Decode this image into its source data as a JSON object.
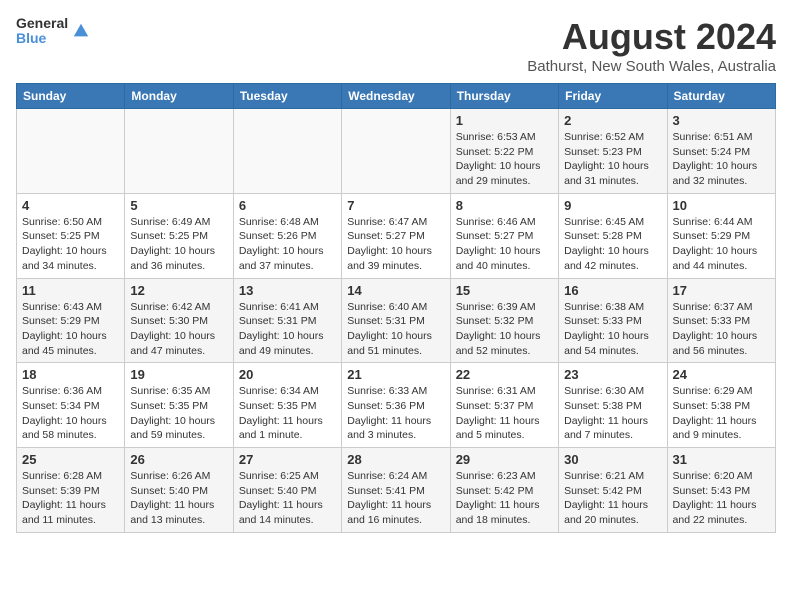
{
  "header": {
    "logo_line1": "General",
    "logo_line2": "Blue",
    "month": "August 2024",
    "location": "Bathurst, New South Wales, Australia"
  },
  "weekdays": [
    "Sunday",
    "Monday",
    "Tuesday",
    "Wednesday",
    "Thursday",
    "Friday",
    "Saturday"
  ],
  "weeks": [
    [
      {
        "day": "",
        "info": ""
      },
      {
        "day": "",
        "info": ""
      },
      {
        "day": "",
        "info": ""
      },
      {
        "day": "",
        "info": ""
      },
      {
        "day": "1",
        "info": "Sunrise: 6:53 AM\nSunset: 5:22 PM\nDaylight: 10 hours\nand 29 minutes."
      },
      {
        "day": "2",
        "info": "Sunrise: 6:52 AM\nSunset: 5:23 PM\nDaylight: 10 hours\nand 31 minutes."
      },
      {
        "day": "3",
        "info": "Sunrise: 6:51 AM\nSunset: 5:24 PM\nDaylight: 10 hours\nand 32 minutes."
      }
    ],
    [
      {
        "day": "4",
        "info": "Sunrise: 6:50 AM\nSunset: 5:25 PM\nDaylight: 10 hours\nand 34 minutes."
      },
      {
        "day": "5",
        "info": "Sunrise: 6:49 AM\nSunset: 5:25 PM\nDaylight: 10 hours\nand 36 minutes."
      },
      {
        "day": "6",
        "info": "Sunrise: 6:48 AM\nSunset: 5:26 PM\nDaylight: 10 hours\nand 37 minutes."
      },
      {
        "day": "7",
        "info": "Sunrise: 6:47 AM\nSunset: 5:27 PM\nDaylight: 10 hours\nand 39 minutes."
      },
      {
        "day": "8",
        "info": "Sunrise: 6:46 AM\nSunset: 5:27 PM\nDaylight: 10 hours\nand 40 minutes."
      },
      {
        "day": "9",
        "info": "Sunrise: 6:45 AM\nSunset: 5:28 PM\nDaylight: 10 hours\nand 42 minutes."
      },
      {
        "day": "10",
        "info": "Sunrise: 6:44 AM\nSunset: 5:29 PM\nDaylight: 10 hours\nand 44 minutes."
      }
    ],
    [
      {
        "day": "11",
        "info": "Sunrise: 6:43 AM\nSunset: 5:29 PM\nDaylight: 10 hours\nand 45 minutes."
      },
      {
        "day": "12",
        "info": "Sunrise: 6:42 AM\nSunset: 5:30 PM\nDaylight: 10 hours\nand 47 minutes."
      },
      {
        "day": "13",
        "info": "Sunrise: 6:41 AM\nSunset: 5:31 PM\nDaylight: 10 hours\nand 49 minutes."
      },
      {
        "day": "14",
        "info": "Sunrise: 6:40 AM\nSunset: 5:31 PM\nDaylight: 10 hours\nand 51 minutes."
      },
      {
        "day": "15",
        "info": "Sunrise: 6:39 AM\nSunset: 5:32 PM\nDaylight: 10 hours\nand 52 minutes."
      },
      {
        "day": "16",
        "info": "Sunrise: 6:38 AM\nSunset: 5:33 PM\nDaylight: 10 hours\nand 54 minutes."
      },
      {
        "day": "17",
        "info": "Sunrise: 6:37 AM\nSunset: 5:33 PM\nDaylight: 10 hours\nand 56 minutes."
      }
    ],
    [
      {
        "day": "18",
        "info": "Sunrise: 6:36 AM\nSunset: 5:34 PM\nDaylight: 10 hours\nand 58 minutes."
      },
      {
        "day": "19",
        "info": "Sunrise: 6:35 AM\nSunset: 5:35 PM\nDaylight: 10 hours\nand 59 minutes."
      },
      {
        "day": "20",
        "info": "Sunrise: 6:34 AM\nSunset: 5:35 PM\nDaylight: 11 hours\nand 1 minute."
      },
      {
        "day": "21",
        "info": "Sunrise: 6:33 AM\nSunset: 5:36 PM\nDaylight: 11 hours\nand 3 minutes."
      },
      {
        "day": "22",
        "info": "Sunrise: 6:31 AM\nSunset: 5:37 PM\nDaylight: 11 hours\nand 5 minutes."
      },
      {
        "day": "23",
        "info": "Sunrise: 6:30 AM\nSunset: 5:38 PM\nDaylight: 11 hours\nand 7 minutes."
      },
      {
        "day": "24",
        "info": "Sunrise: 6:29 AM\nSunset: 5:38 PM\nDaylight: 11 hours\nand 9 minutes."
      }
    ],
    [
      {
        "day": "25",
        "info": "Sunrise: 6:28 AM\nSunset: 5:39 PM\nDaylight: 11 hours\nand 11 minutes."
      },
      {
        "day": "26",
        "info": "Sunrise: 6:26 AM\nSunset: 5:40 PM\nDaylight: 11 hours\nand 13 minutes."
      },
      {
        "day": "27",
        "info": "Sunrise: 6:25 AM\nSunset: 5:40 PM\nDaylight: 11 hours\nand 14 minutes."
      },
      {
        "day": "28",
        "info": "Sunrise: 6:24 AM\nSunset: 5:41 PM\nDaylight: 11 hours\nand 16 minutes."
      },
      {
        "day": "29",
        "info": "Sunrise: 6:23 AM\nSunset: 5:42 PM\nDaylight: 11 hours\nand 18 minutes."
      },
      {
        "day": "30",
        "info": "Sunrise: 6:21 AM\nSunset: 5:42 PM\nDaylight: 11 hours\nand 20 minutes."
      },
      {
        "day": "31",
        "info": "Sunrise: 6:20 AM\nSunset: 5:43 PM\nDaylight: 11 hours\nand 22 minutes."
      }
    ]
  ]
}
